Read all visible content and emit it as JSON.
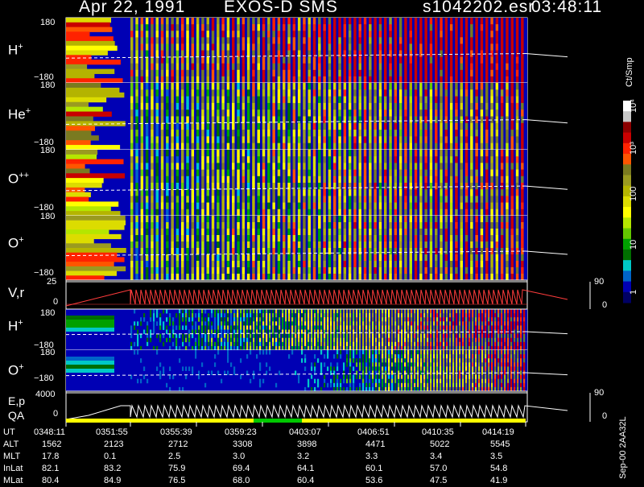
{
  "header": {
    "date": "Apr 22, 1991",
    "instrument": "EXOS-D SMS",
    "file": "s1042202.esr",
    "time": "03:48:11"
  },
  "colorbar": {
    "unit": "Ct/Smp",
    "ticks": [
      "10⁴",
      "10³",
      "100",
      "10",
      "1"
    ],
    "colors": [
      "#ffffff",
      "#c8c8c8",
      "#8b0000",
      "#c80000",
      "#ff2200",
      "#ff5500",
      "#7a7a20",
      "#9a9a20",
      "#b4b400",
      "#dcdc00",
      "#ffff00",
      "#b4e600",
      "#64c800",
      "#00a000",
      "#006e00",
      "#00c8c8",
      "#0064c8",
      "#0000b4",
      "#000064"
    ]
  },
  "panels": [
    {
      "id": "H+",
      "ion": "H",
      "charge": "+",
      "ymax": "180",
      "ymin": "−180"
    },
    {
      "id": "He+",
      "ion": "He",
      "charge": "+",
      "ymax": "180",
      "ymin": "−180"
    },
    {
      "id": "O++",
      "ion": "O",
      "charge": "++",
      "ymax": "180",
      "ymin": "−180"
    },
    {
      "id": "O+",
      "ion": "O",
      "charge": "+",
      "ymax": "180",
      "ymin": "−180"
    },
    {
      "id": "H+2",
      "ion": "H",
      "charge": "+",
      "ymax": "180",
      "ymin": "−180"
    },
    {
      "id": "O+2",
      "ion": "O",
      "charge": "+",
      "ymax": "180",
      "ymin": "−180"
    }
  ],
  "vr_panel": {
    "label": "V,r",
    "ymax": "25",
    "ymin": "0",
    "right_top": "90",
    "right_bottom": "0"
  },
  "ep_panel": {
    "label_top": "E,p",
    "label_bottom": "QA",
    "ymax": "4000",
    "ymin": "0",
    "right_top": "90",
    "right_bottom": "0"
  },
  "chart_data": {
    "type": "heatmap",
    "title": "Apr 22, 1991  EXOS-D SMS",
    "series": [
      {
        "name": "H+",
        "ylim": [
          -180,
          180
        ]
      },
      {
        "name": "He+",
        "ylim": [
          -180,
          180
        ]
      },
      {
        "name": "O++",
        "ylim": [
          -180,
          180
        ]
      },
      {
        "name": "O+",
        "ylim": [
          -180,
          180
        ]
      },
      {
        "name": "V,r",
        "ylim": [
          0,
          25
        ]
      },
      {
        "name": "H+",
        "ylim": [
          -180,
          180
        ]
      },
      {
        "name": "O+",
        "ylim": [
          -180,
          180
        ]
      },
      {
        "name": "E,p",
        "ylim": [
          0,
          4000
        ]
      }
    ],
    "colorscale": {
      "label": "Ct/Smp",
      "ticks": [
        "1",
        "10",
        "100",
        "10³",
        "10⁴"
      ]
    },
    "x_tick_labels": [
      "0348:11",
      "0351:55",
      "0355:39",
      "0359:23",
      "0403:07",
      "0406:51",
      "0410:35",
      "0414:19"
    ]
  },
  "orbit": {
    "rows": [
      {
        "label": "UT",
        "values": [
          "0348:11",
          "0351:55",
          "0355:39",
          "0359:23",
          "0403:07",
          "0406:51",
          "0410:35",
          "0414:19"
        ]
      },
      {
        "label": "ALT",
        "values": [
          "1562",
          "2123",
          "2712",
          "3308",
          "3898",
          "4471",
          "5022",
          "5545"
        ]
      },
      {
        "label": "MLT",
        "values": [
          "17.8",
          "0.1",
          "2.5",
          "3.0",
          "3.2",
          "3.3",
          "3.4",
          "3.5"
        ]
      },
      {
        "label": "InLat",
        "values": [
          "82.1",
          "83.2",
          "75.9",
          "69.4",
          "64.1",
          "60.1",
          "57.0",
          "54.8"
        ]
      },
      {
        "label": "MLat",
        "values": [
          "80.4",
          "84.9",
          "76.5",
          "68.0",
          "60.4",
          "53.6",
          "47.5",
          "41.9"
        ]
      }
    ]
  },
  "stamp": "Sep-00  2AA32L"
}
